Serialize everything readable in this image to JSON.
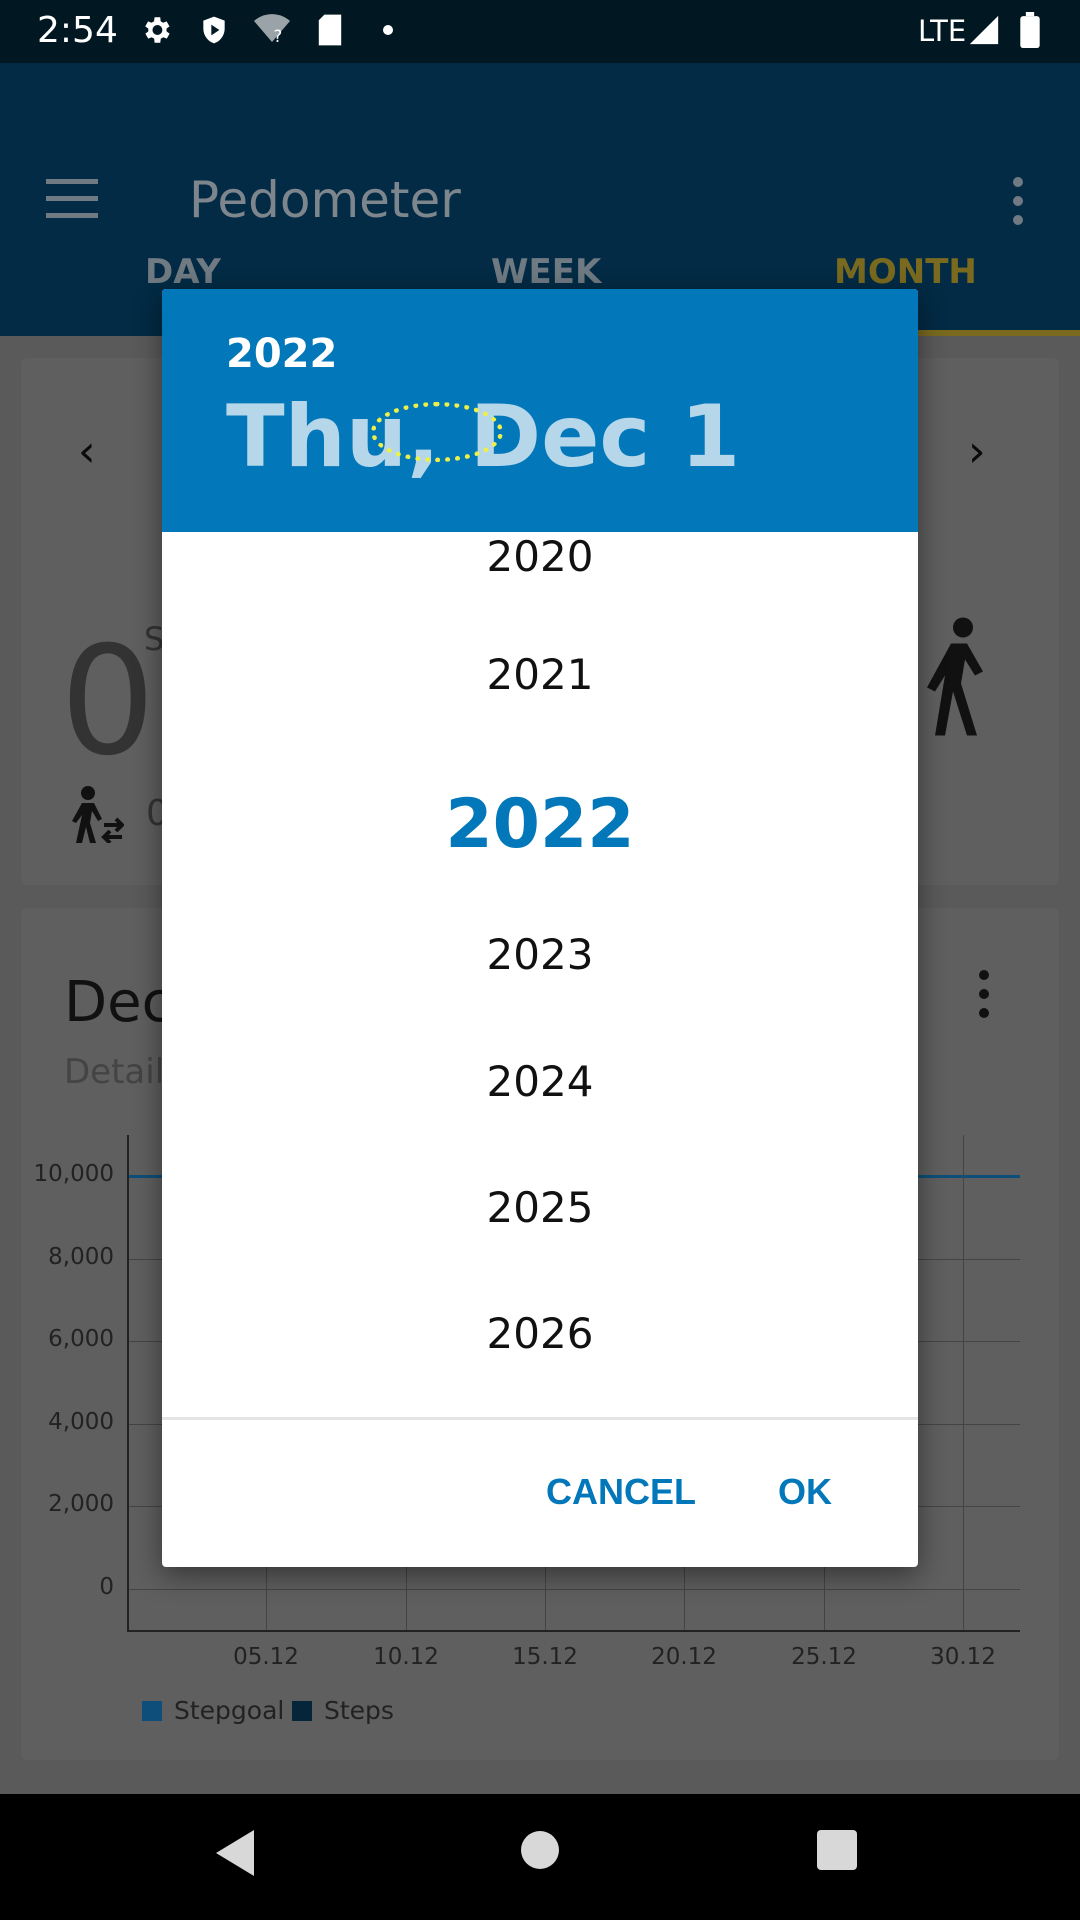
{
  "status_bar": {
    "time": "2:54",
    "network": "LTE",
    "icons": [
      "gear-icon",
      "shield-icon",
      "wifi-unknown-icon",
      "sd-card-icon",
      "dot-icon",
      "signal-icon",
      "battery-icon"
    ]
  },
  "app_bar": {
    "title": "Pedometer",
    "tabs": [
      {
        "label": "DAY"
      },
      {
        "label": "WEEK"
      },
      {
        "label": "MONTH",
        "active": true
      }
    ]
  },
  "summary_card": {
    "steps_value": "0",
    "partial_label": "S",
    "distance_value": "0"
  },
  "chart_card": {
    "title_partial": "Dec",
    "subtitle_partial": "Detaile"
  },
  "chart_data": {
    "type": "bar",
    "x_tick_labels": [
      "05.12",
      "10.12",
      "15.12",
      "20.12",
      "25.12",
      "30.12"
    ],
    "y_tick_labels": [
      "10,000",
      "8,000",
      "6,000",
      "4,000",
      "2,000",
      "0"
    ],
    "ylim": [
      0,
      10000
    ],
    "series": [
      {
        "name": "Stepgoal",
        "values": [
          10000
        ]
      },
      {
        "name": "Steps",
        "values": [
          0
        ]
      }
    ],
    "legend": "bottom-left",
    "grid": true
  },
  "dialog": {
    "header_year": "2022",
    "header_date": "Thu, Dec 1",
    "years": [
      "2020",
      "2021",
      "2022",
      "2023",
      "2024",
      "2025",
      "2026"
    ],
    "selected_year": "2022",
    "cancel_label": "CANCEL",
    "ok_label": "OK"
  },
  "colors": {
    "accent": "#0277b9",
    "app_bar": "#032b45",
    "status_bar": "#011823"
  }
}
